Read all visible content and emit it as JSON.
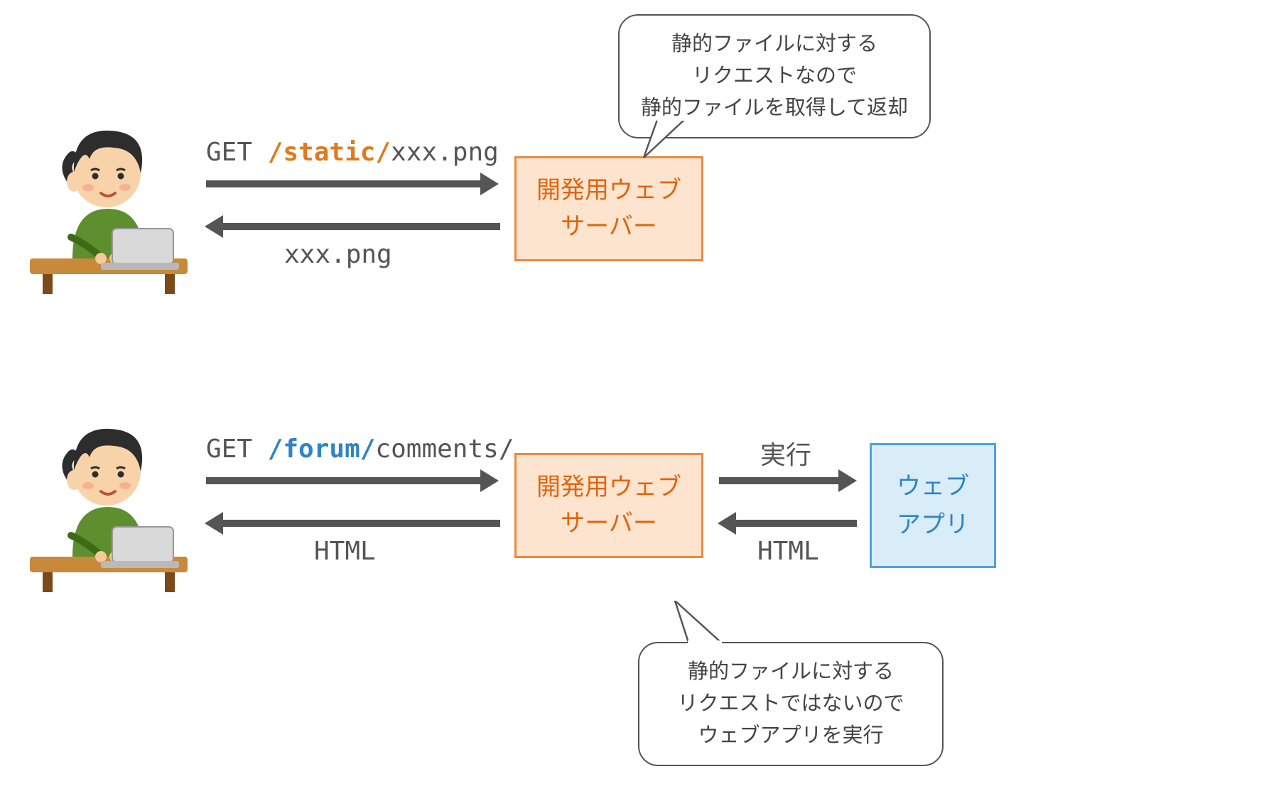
{
  "flow1": {
    "request": {
      "method": "GET ",
      "path_hi": "/static/",
      "path_rest": "xxx.png"
    },
    "response": "xxx.png",
    "server": {
      "line1": "開発用ウェブ",
      "line2": "サーバー"
    },
    "bubble": {
      "l1": "静的ファイルに対する",
      "l2": "リクエストなので",
      "l3": "静的ファイルを取得して返却"
    }
  },
  "flow2": {
    "request": {
      "method": "GET ",
      "path_hi": "/forum/",
      "path_rest": "comments/"
    },
    "response": "HTML",
    "server": {
      "line1": "開発用ウェブ",
      "line2": "サーバー"
    },
    "exec_label": "実行",
    "exec_response": "HTML",
    "app": {
      "line1": "ウェブ",
      "line2": "アプリ"
    },
    "bubble": {
      "l1": "静的ファイルに対する",
      "l2": "リクエストではないので",
      "l3": "ウェブアプリを実行"
    }
  }
}
